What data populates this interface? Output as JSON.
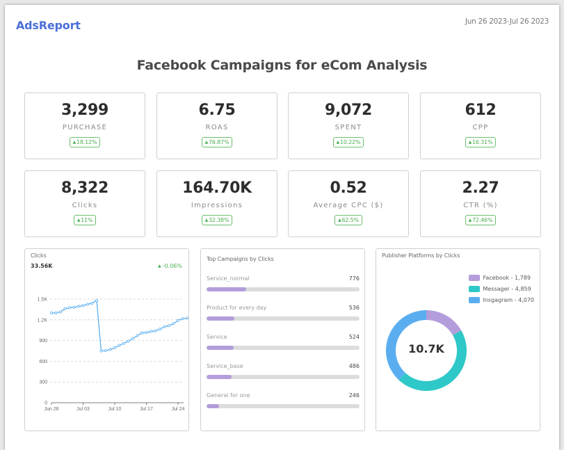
{
  "header": {
    "brand": "AdsReport",
    "date_range": "Jun 26 2023-Jul 26 2023",
    "title": "Facebook Campaigns for eCom Analysis"
  },
  "kpis": [
    {
      "value": "3,299",
      "label": "PURCHASE",
      "change": "18.12%",
      "direction": "up"
    },
    {
      "value": "6.75",
      "label": "ROAS",
      "change": "76.87%",
      "direction": "up"
    },
    {
      "value": "9,072",
      "label": "SPENT",
      "change": "10.22%",
      "direction": "up"
    },
    {
      "value": "612",
      "label": "CPP",
      "change": "16.31%",
      "direction": "up"
    },
    {
      "value": "8,322",
      "label": "Clicks",
      "change": "11%",
      "direction": "up"
    },
    {
      "value": "164.70K",
      "label": "Impressions",
      "change": "32.38%",
      "direction": "up"
    },
    {
      "value": "0.52",
      "label": "Average CPC ($)",
      "change": "62.5%",
      "direction": "up"
    },
    {
      "value": "2.27",
      "label": "CTR (%)",
      "change": "72.46%",
      "direction": "up"
    }
  ],
  "colors": {
    "brand": "#4a6fd8",
    "positive": "#4caf50",
    "line": "#5aaef0",
    "bar_fill": "#b39ddb",
    "bar_track": "#dcdcdc",
    "facebook": "#b39ddb",
    "messager": "#2ec8c8",
    "instagram": "#5aaef0"
  },
  "clicks_panel": {
    "title": "Clicks",
    "total": "33.56K",
    "change": "-0.06%",
    "change_icon": "triangle-up-icon"
  },
  "campaigns_panel": {
    "title": "Top Campaigns by Clicks",
    "items": [
      {
        "name": "Service_normal",
        "value": "776",
        "fraction": 0.26
      },
      {
        "name": "Product for every day",
        "value": "536",
        "fraction": 0.18
      },
      {
        "name": "Service",
        "value": "524",
        "fraction": 0.175
      },
      {
        "name": "Service_base",
        "value": "486",
        "fraction": 0.162
      },
      {
        "name": "General for one",
        "value": "246",
        "fraction": 0.082
      }
    ]
  },
  "platforms_panel": {
    "title": "Publisher Platforms by Clicks",
    "center_label": "10.7K"
  },
  "chart_data": [
    {
      "type": "line",
      "title": "Clicks",
      "xlabel": "",
      "ylabel": "",
      "ylim": [
        0,
        1500
      ],
      "yticks": [
        0,
        300,
        600,
        900,
        1200,
        1500
      ],
      "ytick_labels": [
        "0",
        "300",
        "600",
        "900",
        "1.2K",
        "1.5K"
      ],
      "xtick_labels": [
        "Jun 26",
        "Jul 03",
        "Jul 10",
        "Jul 17",
        "Jul 24"
      ],
      "xtick_index": [
        0,
        7,
        14,
        21,
        28
      ],
      "grid": true,
      "series": [
        {
          "name": "Clicks",
          "x": [
            "Jun 26",
            "Jun 27",
            "Jun 28",
            "Jun 29",
            "Jun 30",
            "Jul 01",
            "Jul 02",
            "Jul 03",
            "Jul 04",
            "Jul 05",
            "Jul 06",
            "Jul 07",
            "Jul 08",
            "Jul 09",
            "Jul 10",
            "Jul 11",
            "Jul 12",
            "Jul 13",
            "Jul 14",
            "Jul 15",
            "Jul 16",
            "Jul 17",
            "Jul 18",
            "Jul 19",
            "Jul 20",
            "Jul 21",
            "Jul 22",
            "Jul 23",
            "Jul 24",
            "Jul 25",
            "Jul 26"
          ],
          "values": [
            1300,
            1300,
            1315,
            1360,
            1375,
            1380,
            1395,
            1405,
            1425,
            1440,
            1480,
            750,
            755,
            770,
            795,
            830,
            860,
            890,
            930,
            970,
            1010,
            1015,
            1030,
            1040,
            1065,
            1100,
            1115,
            1145,
            1190,
            1215,
            1225
          ]
        }
      ]
    },
    {
      "type": "bar",
      "title": "Top Campaigns by Clicks",
      "orientation": "horizontal",
      "categories": [
        "Service_normal",
        "Product for every day",
        "Service",
        "Service_base",
        "General for one"
      ],
      "values": [
        776,
        536,
        524,
        486,
        246
      ]
    },
    {
      "type": "pie",
      "title": "Publisher Platforms by Clicks",
      "donut": true,
      "center_label": "10.7K",
      "legend_position": "top-right",
      "categories": [
        "Facebook",
        "Messager",
        "Insgagram"
      ],
      "values": [
        1789,
        4859,
        4070
      ],
      "legend_labels": [
        "Facebook - 1,789",
        "Messager - 4,859",
        "Insgagram - 4,070"
      ]
    }
  ]
}
